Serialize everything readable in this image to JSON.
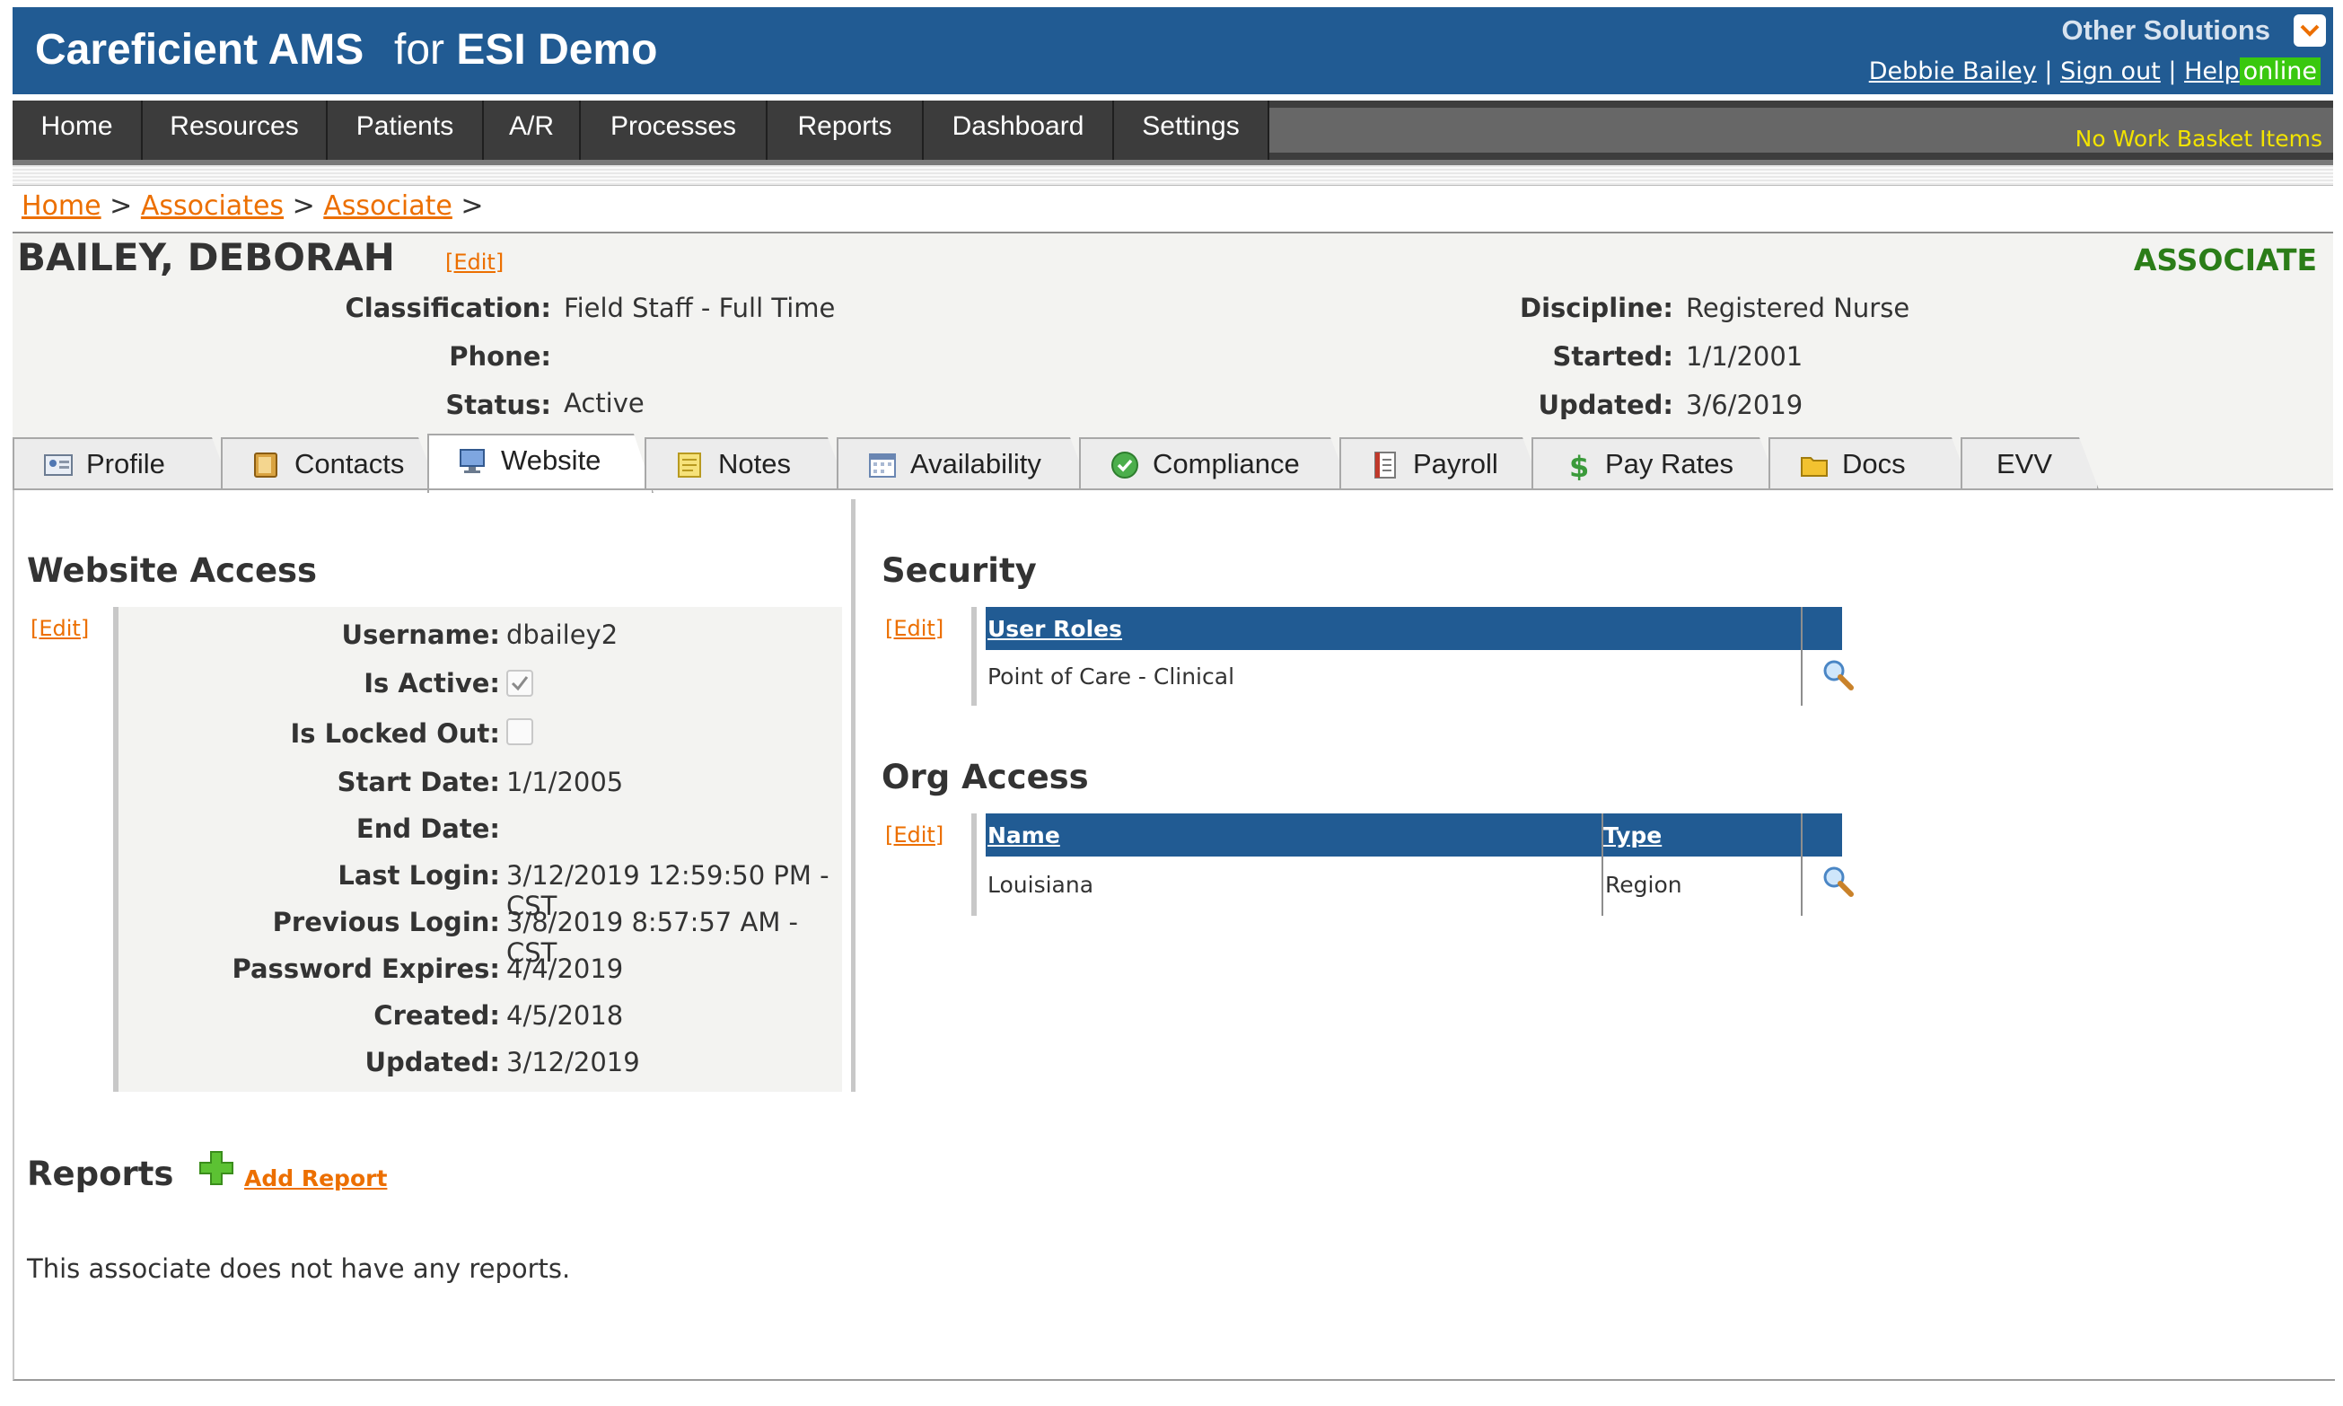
{
  "header": {
    "app_title": "Careficient AMS",
    "app_sub_prefix": "for",
    "app_sub_org": "ESI Demo",
    "other_solutions": "Other Solutions",
    "user_name": "Debbie Bailey",
    "sep": "|",
    "sign_out": "Sign out",
    "help": "Help",
    "online": "online"
  },
  "nav": {
    "items": [
      "Home",
      "Resources",
      "Patients",
      "A/R",
      "Processes",
      "Reports",
      "Dashboard",
      "Settings"
    ],
    "work_basket": "No Work Basket Items"
  },
  "breadcrumb": {
    "items": [
      "Home",
      "Associates",
      "Associate"
    ],
    "sep": ">"
  },
  "associate": {
    "name": "BAILEY, DEBORAH",
    "edit": "[Edit]",
    "type": "ASSOCIATE",
    "classification_label": "Classification:",
    "classification": "Field Staff - Full Time",
    "phone_label": "Phone:",
    "status_label": "Status:",
    "status": "Active",
    "discipline_label": "Discipline:",
    "discipline": "Registered Nurse",
    "started_label": "Started:",
    "started": "1/1/2001",
    "updated_label": "Updated:",
    "updated": "3/6/2019"
  },
  "tabs": [
    {
      "label": "Profile",
      "icon": "profile-card-icon"
    },
    {
      "label": "Contacts",
      "icon": "contacts-book-icon"
    },
    {
      "label": "Website",
      "icon": "website-computer-icon",
      "active": true
    },
    {
      "label": "Notes",
      "icon": "notes-icon"
    },
    {
      "label": "Availability",
      "icon": "calendar-icon"
    },
    {
      "label": "Compliance",
      "icon": "check-circle-icon"
    },
    {
      "label": "Payroll",
      "icon": "payroll-document-icon"
    },
    {
      "label": "Pay Rates",
      "icon": "dollar-icon"
    },
    {
      "label": "Docs",
      "icon": "folder-icon"
    },
    {
      "label": "EVV"
    }
  ],
  "website_access": {
    "title": "Website Access",
    "edit": "[Edit]",
    "username_label": "Username:",
    "username": "dbailey2",
    "is_active_label": "Is Active:",
    "is_active": true,
    "is_locked_out_label": "Is Locked Out:",
    "is_locked_out": false,
    "start_date_label": "Start Date:",
    "start_date": "1/1/2005",
    "end_date_label": "End Date:",
    "last_login_label": "Last Login:",
    "last_login": "3/12/2019 12:59:50 PM -CST",
    "previous_login_label": "Previous Login:",
    "previous_login": "3/8/2019 8:57:57 AM -CST",
    "password_expires_label": "Password Expires:",
    "password_expires": "4/4/2019",
    "created_label": "Created:",
    "created": "4/5/2018",
    "updated_label": "Updated:",
    "updated": "3/12/2019"
  },
  "security": {
    "title": "Security",
    "edit": "[Edit]",
    "column": "User Roles",
    "rows": [
      "Point of Care - Clinical"
    ]
  },
  "org_access": {
    "title": "Org Access",
    "edit": "[Edit]",
    "columns": [
      "Name",
      "Type"
    ],
    "rows": [
      {
        "name": "Louisiana",
        "type": "Region"
      }
    ]
  },
  "reports": {
    "title": "Reports",
    "add_report": "Add Report",
    "empty": "This associate does not have any reports."
  },
  "colors": {
    "brand_blue": "#215b93",
    "link_orange": "#ec6f00",
    "associate_green": "#2b7d18",
    "online_green": "#39c80e",
    "work_basket_yellow": "#f2e300"
  }
}
